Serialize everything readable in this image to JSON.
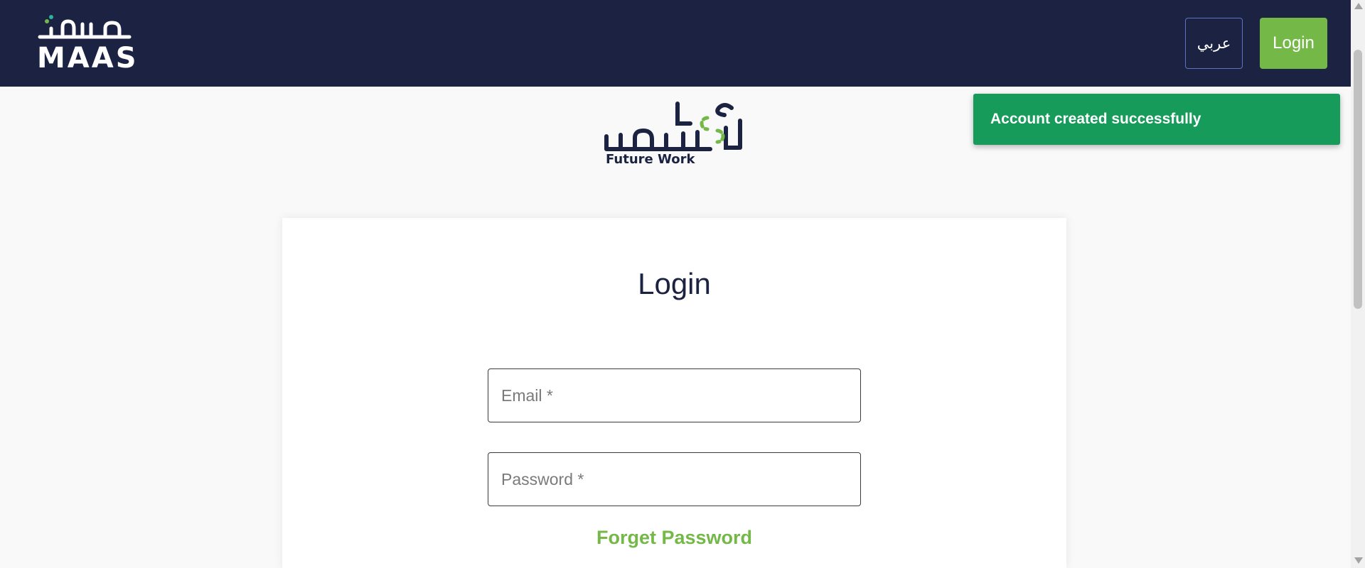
{
  "header": {
    "brand": {
      "arabic_logo_text": "ماس",
      "latin_logo_text": "MAAS"
    },
    "language_toggle_label": "عربي",
    "login_label": "Login",
    "colors": {
      "navy": "#1b2242",
      "green": "#74b848",
      "teal": "#2bb3a0"
    }
  },
  "notification": {
    "message": "Account created successfully",
    "color": "#169b5b"
  },
  "future_work_logo": {
    "arabic_logo_text": "عمل المستقبل",
    "latin_logo_text": "Future Work"
  },
  "login_form": {
    "title": "Login",
    "email_placeholder": "Email *",
    "email_value": "",
    "password_placeholder": "Password *",
    "password_value": "",
    "forgot_password_label": "Forget Password"
  }
}
